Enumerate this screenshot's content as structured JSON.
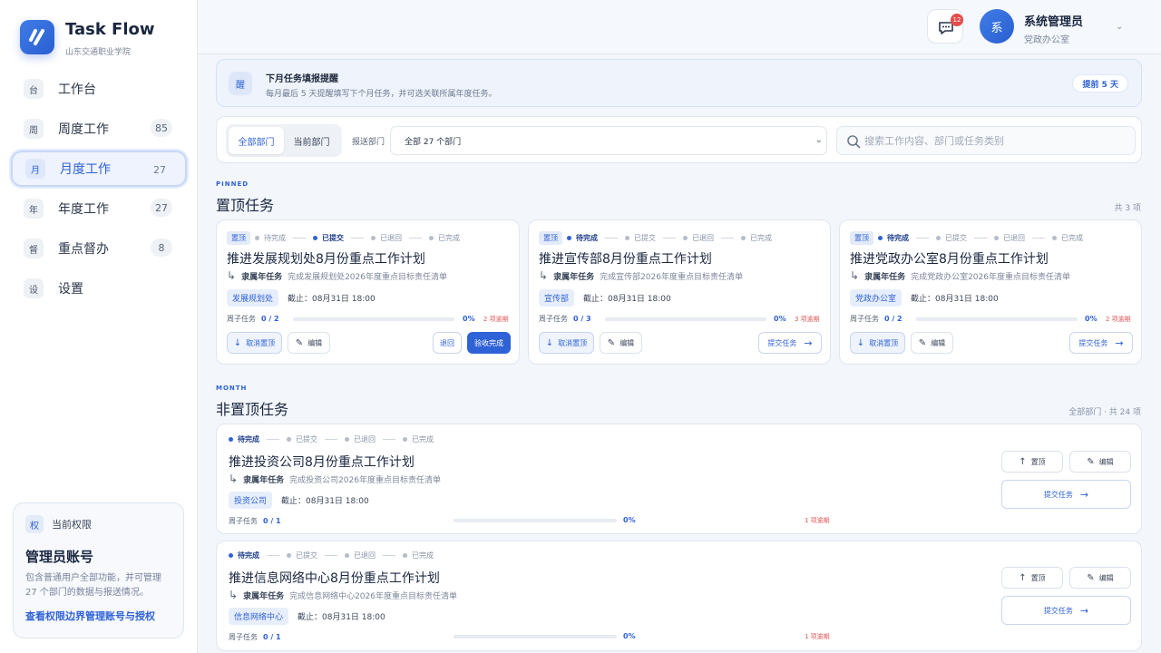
{
  "app": {
    "name": "Task Flow",
    "org": "山东交通职业学院"
  },
  "nav": [
    {
      "icon": "台",
      "label": "工作台",
      "count": ""
    },
    {
      "icon": "周",
      "label": "周度工作",
      "count": "85"
    },
    {
      "icon": "月",
      "label": "月度工作",
      "count": "27",
      "active": true
    },
    {
      "icon": "年",
      "label": "年度工作",
      "count": "27"
    },
    {
      "icon": "督",
      "label": "重点督办",
      "count": "8"
    },
    {
      "icon": "设",
      "label": "设置",
      "count": ""
    }
  ],
  "permission": {
    "icon": "权",
    "head": "当前权限",
    "title": "管理员账号",
    "desc": "包含普通用户全部功能，并可管理 27 个部门的数据与报送情况。",
    "link": "查看权限边界管理账号与授权"
  },
  "user": {
    "avatar": "系",
    "name": "系统管理员",
    "dept": "党政办公室",
    "badge": "12"
  },
  "notice": {
    "icon": "醒",
    "title": "下月任务填报提醒",
    "desc": "每月最后 5 天提醒填写下个月任务，并可选关联所属年度任务。",
    "tag": "提前 5 天"
  },
  "filter": {
    "seg_all": "全部部门",
    "seg_current": "当前部门",
    "label": "报送部门",
    "select": "全部 27 个部门",
    "search_placeholder": "搜索工作内容、部门或任务类别"
  },
  "pinned": {
    "tag": "PINNED",
    "title": "置顶任务",
    "count": "共 3 项"
  },
  "month": {
    "tag": "MONTH",
    "title": "非置顶任务",
    "count": "全部部门 · 共 24 项"
  },
  "common": {
    "pin_label": "置顶",
    "steps": [
      "待完成",
      "已提交",
      "已退回",
      "已完成"
    ],
    "parent_label": "隶属年任务",
    "deadline": "截止：08月31日 18:00",
    "sub_label": "周子任务",
    "unpin": "取消置顶",
    "pin_btn": "置顶",
    "edit": "编辑",
    "return": "退回",
    "accept": "验收完成",
    "submit": "提交任务"
  },
  "pinned_tasks": [
    {
      "title": "推进发展规划处8月份重点工作计划",
      "parent": "完成发展规划处2026年度重点目标责任清单",
      "dept": "发展规划处",
      "sub": "0 / 2",
      "pct": "0%",
      "progress": 0,
      "overdue": "2 项逾期",
      "current_step": 1
    },
    {
      "title": "推进宣传部8月份重点工作计划",
      "parent": "完成宣传部2026年度重点目标责任清单",
      "dept": "宣传部",
      "sub": "0 / 3",
      "pct": "0%",
      "progress": 0,
      "overdue": "3 项逾期",
      "current_step": 0
    },
    {
      "title": "推进党政办公室8月份重点工作计划",
      "parent": "完成党政办公室2026年度重点目标责任清单",
      "dept": "党政办公室",
      "sub": "0 / 2",
      "pct": "0%",
      "progress": 0,
      "overdue": "2 项逾期",
      "current_step": 0
    }
  ],
  "month_tasks": [
    {
      "title": "推进投资公司8月份重点工作计划",
      "parent": "完成投资公司2026年度重点目标责任清单",
      "dept": "投资公司",
      "sub": "0 / 1",
      "pct": "0%",
      "progress": 0,
      "overdue": "1 项逾期"
    },
    {
      "title": "推进信息网络中心8月份重点工作计划",
      "parent": "完成信息网络中心2026年度重点目标责任清单",
      "dept": "信息网络中心",
      "sub": "0 / 1",
      "pct": "0%",
      "progress": 0,
      "overdue": "1 项逾期"
    }
  ]
}
